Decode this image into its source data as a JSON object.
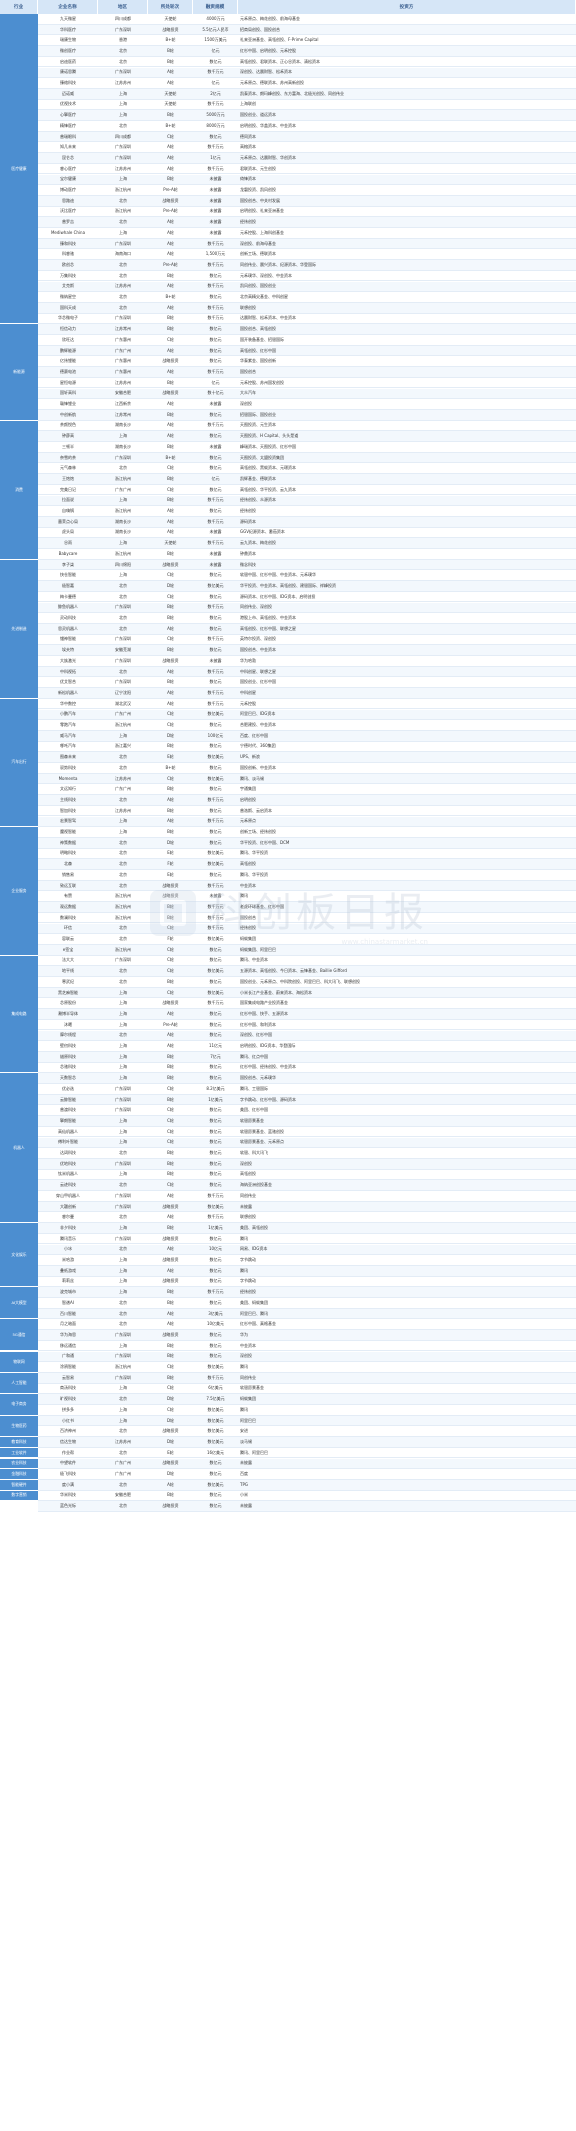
{
  "header": [
    "行业",
    "企业名称",
    "地区",
    "所处轮次",
    "融资规模",
    "投资方"
  ],
  "categories": [
    {
      "name": "医疗健康",
      "rows": 29
    },
    {
      "name": "新能源",
      "rows": 9
    },
    {
      "name": "消费",
      "rows": 13
    },
    {
      "name": "先进制造",
      "rows": 13
    },
    {
      "name": "汽车出行",
      "rows": 12
    },
    {
      "name": "企业服务",
      "rows": 12
    },
    {
      "name": "集成电路",
      "rows": 11
    },
    {
      "name": "机器人",
      "rows": 14
    },
    {
      "name": "文化娱乐",
      "rows": 6
    },
    {
      "name": "AI大模型",
      "rows": 3
    },
    {
      "name": "5G通信",
      "rows": 3
    },
    {
      "name": "物联网",
      "rows": 2
    },
    {
      "name": "人工智能",
      "rows": 2
    },
    {
      "name": "电子商务",
      "rows": 2
    },
    {
      "name": "生物医药",
      "rows": 2
    },
    {
      "name": "教育科技",
      "rows": 1
    },
    {
      "name": "工业软件",
      "rows": 1
    },
    {
      "name": "农业科技",
      "rows": 1
    },
    {
      "name": "金融科技",
      "rows": 1
    },
    {
      "name": "智能硬件",
      "rows": 1
    },
    {
      "name": "数字营销",
      "rows": 1
    }
  ],
  "rows": [
    [
      "九天微星",
      "四川成都",
      "天使轮",
      "4000万元",
      "元禾原点、梅花创投、前海母基金"
    ],
    [
      "华科医疗",
      "广东深圳",
      "战略投资",
      "5.5亿元人民币",
      "招商局创投、国投创合"
    ],
    [
      "瑞康生物",
      "香港",
      "B+轮",
      "1500万美元",
      "礼来亚洲基金、高瓴创投、F-Prime Capital"
    ],
    [
      "微创医疗",
      "北京",
      "B轮",
      "亿元",
      "红杉中国、启明创投、元禾控股"
    ],
    [
      "启迪医药",
      "北京",
      "B轮",
      "数亿元",
      "高瓴创投、君联资本、正心谷资本、清松资本"
    ],
    [
      "康诺思腾",
      "广东深圳",
      "A轮",
      "数千万元",
      "深创投、达晨财智、松禾资本"
    ],
    [
      "臻络科技",
      "江苏苏州",
      "A轮",
      "亿元",
      "元禾原点、德联资本、苏州高新创投"
    ],
    [
      "迈诺威",
      "上海",
      "天使轮",
      "2亿元",
      "凯泰资本、朗玛峰创投、东方富海、北极光创投、同创伟业"
    ],
    [
      "优视技术",
      "上海",
      "天使轮",
      "数千万元",
      "上海联创"
    ],
    [
      "心擎医疗",
      "上海",
      "B轮",
      "5000万元",
      "国投创业、道远资本"
    ],
    [
      "精锋医疗",
      "北京",
      "B+轮",
      "8000万元",
      "启明创投、华盖资本、中金资本"
    ],
    [
      "普瑞眼科",
      "四川成都",
      "C轮",
      "数亿元",
      "德同资本"
    ],
    [
      "知几未来",
      "广东深圳",
      "A轮",
      "数千万元",
      "高榕资本"
    ],
    [
      "昆仑芯",
      "广东深圳",
      "A轮",
      "1亿元",
      "元禾原点、达晨财智、华创资本"
    ],
    [
      "睿心医疗",
      "江苏苏州",
      "A轮",
      "数千万元",
      "君联资本、元生创投"
    ],
    [
      "宝尔健康",
      "上海",
      "B轮",
      "未披露",
      "倚锋资本"
    ],
    [
      "博动医疗",
      "浙江杭州",
      "Pre-A轮",
      "未披露",
      "龙磐投资、凯风创投"
    ],
    [
      "思路迪",
      "北京",
      "战略投资",
      "未披露",
      "国投创合、中关村发展"
    ],
    [
      "沃比医疗",
      "浙江杭州",
      "Pre-A轮",
      "未披露",
      "启明创投、礼来亚洲基金"
    ],
    [
      "普罗吉",
      "北京",
      "A轮",
      "未披露",
      "经纬创投"
    ],
    [
      "Mediwhale China",
      "上海",
      "A轮",
      "未披露",
      "元禾控股、上海科创基金"
    ],
    [
      "臻和科技",
      "广东深圳",
      "A轮",
      "数千万元",
      "深创投、前海母基金"
    ],
    [
      "科睿驰",
      "海南海口",
      "A轮",
      "1,500万元",
      "创新工场、德联资本"
    ],
    [
      "欧创芯",
      "北京",
      "Pre-A轮",
      "数千万元",
      "同创伟业、晨兴资本、纪源资本、华登国际"
    ],
    [
      "万集科技",
      "北京",
      "B轮",
      "数亿元",
      "元禾璞华、深创投、中金资本"
    ],
    [
      "艾克斯",
      "江苏苏州",
      "A轮",
      "数千万元",
      "凯风创投、国投创业"
    ],
    [
      "微纳星空",
      "北京",
      "B+轮",
      "数亿元",
      "北京高精尖基金、中科创星"
    ],
    [
      "国科天成",
      "北京",
      "A轮",
      "数千万元",
      "联想创投"
    ],
    [
      "华芯微电子",
      "广东深圳",
      "B轮",
      "数千万元",
      "达晨财智、松禾资本、中金资本"
    ],
    [
      "恒信动力",
      "江苏常州",
      "B轮",
      "数亿元",
      "国投创合、高瓴创投"
    ],
    [
      "欣旺达",
      "广东惠州",
      "C轮",
      "数亿元",
      "国开装备基金、招银国际"
    ],
    [
      "鹏辉能源",
      "广东广州",
      "A轮",
      "数亿元",
      "高瓴创投、红杉中国"
    ],
    [
      "亿纬锂能",
      "广东惠州",
      "战略投资",
      "数亿元",
      "华泰紫金、国投创新"
    ],
    [
      "德赛电池",
      "广东惠州",
      "A轮",
      "数千万元",
      "国投创合"
    ],
    [
      "星恒电源",
      "江苏苏州",
      "B轮",
      "亿元",
      "元禾控股、苏州国发创投"
    ],
    [
      "国轩高科",
      "安徽合肥",
      "战略投资",
      "数十亿元",
      "大众汽车"
    ],
    [
      "赣锋锂业",
      "江西新余",
      "A轮",
      "未披露",
      "深创投"
    ],
    [
      "中创新航",
      "江苏常州",
      "B轮",
      "数亿元",
      "招银国际、国投创业"
    ],
    [
      "茶颜悦色",
      "湖南长沙",
      "A轮",
      "数千万元",
      "天图投资、元生资本"
    ],
    [
      "钟薛高",
      "上海",
      "A轮",
      "数亿元",
      "天图投资、H Capital、头头是道"
    ],
    [
      "三顿半",
      "湖南长沙",
      "B轮",
      "未披露",
      "峰瑞资本、天图投资、红杉中国"
    ],
    [
      "奈雪的茶",
      "广东深圳",
      "B+轮",
      "数亿元",
      "天图投资、太盟投资集团"
    ],
    [
      "元气森林",
      "北京",
      "C轮",
      "数亿元",
      "高瓴创投、黑蚁资本、元璟资本"
    ],
    [
      "王饱饱",
      "浙江杭州",
      "B轮",
      "亿元",
      "凯辉基金、德联资本"
    ],
    [
      "完美日记",
      "广东广州",
      "C轮",
      "数亿元",
      "高瓴创投、华平投资、云九资本"
    ],
    [
      "拉面说",
      "上海",
      "B轮",
      "数千万元",
      "经纬创投、众源资本"
    ],
    [
      "自嗨锅",
      "浙江杭州",
      "A轮",
      "数亿元",
      "经纬创投"
    ],
    [
      "墨茉点心局",
      "湖南长沙",
      "A轮",
      "数千万元",
      "源码资本"
    ],
    [
      "虎头局",
      "湖南长沙",
      "A轮",
      "未披露",
      "GGV纪源资本、番茄资本"
    ],
    [
      "谷雨",
      "上海",
      "天使轮",
      "数千万元",
      "云九资本、梅花创投"
    ],
    [
      "Babycare",
      "浙江杭州",
      "B轮",
      "未披露",
      "钟鼎资本"
    ],
    [
      "李子柒",
      "四川绵阳",
      "战略投资",
      "未披露",
      "微念科技"
    ],
    [
      "快仓智能",
      "上海",
      "C轮",
      "数亿元",
      "软银中国、红杉中国、中金资本、元禾璞华"
    ],
    [
      "极智嘉",
      "北京",
      "D轮",
      "数亿美元",
      "华平投资、中金资本、高瓴创投、建银国际、祥峰投资"
    ],
    [
      "梅卡曼德",
      "北京",
      "C轮",
      "数亿元",
      "源码资本、红杉中国、IDG资本、启明创投"
    ],
    [
      "鲸鱼机器人",
      "广东深圳",
      "B轮",
      "数千万元",
      "同创伟业、深创投"
    ],
    [
      "灵动科技",
      "北京",
      "B轮",
      "数亿元",
      "港股上市、高瓴创投、中金资本"
    ],
    [
      "思灵机器人",
      "北京",
      "A轮",
      "数亿元",
      "高瓴创投、红杉中国、联想之星"
    ],
    [
      "镭神智能",
      "广东深圳",
      "C轮",
      "数千万元",
      "英特尔投资、深创投"
    ],
    [
      "埃夫特",
      "安徽芜湖",
      "B轮",
      "数亿元",
      "国投创合、中金资本"
    ],
    [
      "大族激光",
      "广东深圳",
      "战略投资",
      "未披露",
      "华为哈勃"
    ],
    [
      "中科视拓",
      "北京",
      "A轮",
      "数千万元",
      "中科创星、联想之星"
    ],
    [
      "优艾智合",
      "广东深圳",
      "B轮",
      "数亿元",
      "国投创业、红杉中国"
    ],
    [
      "新松机器人",
      "辽宁沈阳",
      "A轮",
      "数千万元",
      "中科创星"
    ],
    [
      "华中数控",
      "湖北武汉",
      "A轮",
      "数千万元",
      "元禾控股"
    ],
    [
      "小鹏汽车",
      "广东广州",
      "C轮",
      "数亿美元",
      "阿里巴巴、IDG资本"
    ],
    [
      "零跑汽车",
      "浙江杭州",
      "C轮",
      "数亿元",
      "合肥建投、中金资本"
    ],
    [
      "威马汽车",
      "上海",
      "D轮",
      "100亿元",
      "百度、红杉中国"
    ],
    [
      "哪吒汽车",
      "浙江嘉兴",
      "B轮",
      "数亿元",
      "宁德时代、360集团"
    ],
    [
      "图森未来",
      "北京",
      "E轮",
      "数亿美元",
      "UPS、新浪"
    ],
    [
      "驭势科技",
      "北京",
      "B+轮",
      "数亿元",
      "国投创新、中金资本"
    ],
    [
      "Momenta",
      "江苏苏州",
      "C轮",
      "数亿美元",
      "腾讯、淡马锡"
    ],
    [
      "文远知行",
      "广东广州",
      "B轮",
      "数亿元",
      "宇通集团"
    ],
    [
      "主线科技",
      "北京",
      "A轮",
      "数千万元",
      "启明创投"
    ],
    [
      "智加科技",
      "江苏苏州",
      "B轮",
      "数亿元",
      "普洛斯、云启资本"
    ],
    [
      "宏景智驾",
      "上海",
      "A轮",
      "数千万元",
      "元禾原点"
    ],
    [
      "魔视智能",
      "上海",
      "B轮",
      "数亿元",
      "创新工场、经纬创投"
    ],
    [
      "神策数据",
      "北京",
      "D轮",
      "数亿元",
      "华平投资、红杉中国、DCM"
    ],
    [
      "明略科技",
      "北京",
      "E轮",
      "数亿美元",
      "腾讯、华平投资"
    ],
    [
      "北森",
      "北京",
      "F轮",
      "数亿美元",
      "高瓴创投"
    ],
    [
      "销售易",
      "北京",
      "E轮",
      "数亿元",
      "腾讯、华平投资"
    ],
    [
      "致远互联",
      "北京",
      "战略投资",
      "数千万元",
      "中金资本"
    ],
    [
      "有赞",
      "浙江杭州",
      "战略投资",
      "未披露",
      "腾讯"
    ],
    [
      "观远数据",
      "浙江杭州",
      "B轮",
      "数千万元",
      "老虎环球基金、红杉中国"
    ],
    [
      "数澜科技",
      "浙江杭州",
      "B轮",
      "数千万元",
      "国投创合"
    ],
    [
      "环信",
      "北京",
      "C轮",
      "数千万元",
      "经纬创投"
    ],
    [
      "容联云",
      "北京",
      "F轮",
      "数亿美元",
      "蚂蚁集团"
    ],
    [
      "e签宝",
      "浙江杭州",
      "C轮",
      "数亿元",
      "蚂蚁集团、阿里巴巴"
    ],
    [
      "法大大",
      "广东深圳",
      "C轮",
      "数亿元",
      "腾讯、中金资本"
    ],
    [
      "地平线",
      "北京",
      "C轮",
      "数亿美元",
      "五源资本、高瓴创投、今日资本、云锋基金、Baillie Gifford"
    ],
    [
      "寒武纪",
      "北京",
      "B轮",
      "数亿元",
      "国投创业、元禾原点、中科院创投、阿里巴巴、科大讯飞、联想创投"
    ],
    [
      "黑芝麻智能",
      "上海",
      "C轮",
      "数亿美元",
      "小米长江产业基金、蔚来资本、海松资本"
    ],
    [
      "芯原股份",
      "上海",
      "战略投资",
      "数千万元",
      "国家集成电路产业投资基金"
    ],
    [
      "瀚博半导体",
      "上海",
      "A轮",
      "数亿元",
      "红杉中国、快手、五源资本"
    ],
    [
      "沐曦",
      "上海",
      "Pre-A轮",
      "数亿元",
      "红杉中国、和利资本"
    ],
    [
      "摩尔线程",
      "北京",
      "A轮",
      "数亿元",
      "深创投、红杉中国"
    ],
    [
      "壁仞科技",
      "上海",
      "A轮",
      "11亿元",
      "启明创投、IDG资本、华登国际"
    ],
    [
      "燧原科技",
      "上海",
      "B轮",
      "7亿元",
      "腾讯、红点中国"
    ],
    [
      "芯驰科技",
      "上海",
      "B轮",
      "数亿元",
      "红杉中国、经纬创投、中金资本"
    ],
    [
      "天数智芯",
      "上海",
      "B轮",
      "数亿元",
      "国投创合、元禾璞华"
    ],
    [
      "优必选",
      "广东深圳",
      "C轮",
      "8.2亿美元",
      "腾讯、工银国际"
    ],
    [
      "云鲸智能",
      "广东深圳",
      "B轮",
      "1亿美元",
      "字节跳动、红杉中国、源码资本"
    ],
    [
      "普渡科技",
      "广东深圳",
      "C轮",
      "数亿元",
      "美团、红杉中国"
    ],
    [
      "擎朗智能",
      "上海",
      "C轮",
      "数亿元",
      "软银愿景基金"
    ],
    [
      "高仙机器人",
      "上海",
      "C轮",
      "数亿元",
      "软银愿景基金、蓝驰创投"
    ],
    [
      "傅利叶智能",
      "上海",
      "C轮",
      "数亿元",
      "软银愿景基金、元禾原点"
    ],
    [
      "达闼科技",
      "北京",
      "B轮",
      "数亿元",
      "软银、科大讯飞"
    ],
    [
      "优地科技",
      "广东深圳",
      "B轮",
      "数亿元",
      "深创投"
    ],
    [
      "钛米机器人",
      "上海",
      "B轮",
      "数亿元",
      "高瓴创投"
    ],
    [
      "云迹科技",
      "北京",
      "C轮",
      "数亿元",
      "海纳亚洲创投基金"
    ],
    [
      "穿山甲机器人",
      "广东深圳",
      "A轮",
      "数千万元",
      "同创伟业"
    ],
    [
      "大疆创新",
      "广东深圳",
      "战略投资",
      "数亿美元",
      "未披露"
    ],
    [
      "睿尔曼",
      "北京",
      "A轮",
      "数千万元",
      "联想创投"
    ],
    [
      "非夕科技",
      "上海",
      "B轮",
      "1亿美元",
      "美团、高瓴创投"
    ],
    [
      "腾讯音乐",
      "广东深圳",
      "战略投资",
      "数亿元",
      "腾讯"
    ],
    [
      "小冰",
      "北京",
      "A轮",
      "10亿元",
      "网易、IDG资本"
    ],
    [
      "米哈游",
      "上海",
      "战略投资",
      "数亿元",
      "字节跳动"
    ],
    [
      "叠纸游戏",
      "上海",
      "A轮",
      "数亿元",
      "腾讯"
    ],
    [
      "莉莉丝",
      "上海",
      "战略投资",
      "数亿元",
      "字节跳动"
    ],
    [
      "波克城市",
      "上海",
      "B轮",
      "数千万元",
      "经纬创投"
    ],
    [
      "智谱AI",
      "北京",
      "B轮",
      "数亿元",
      "美团、蚂蚁集团"
    ],
    [
      "百川智能",
      "北京",
      "A轮",
      "3亿美元",
      "阿里巴巴、腾讯"
    ],
    [
      "月之暗面",
      "北京",
      "A轮",
      "10亿美元",
      "红杉中国、真格基金"
    ],
    [
      "华为海思",
      "广东深圳",
      "战略投资",
      "数亿元",
      "华为"
    ],
    [
      "移远通信",
      "上海",
      "B轮",
      "数亿元",
      "中金资本"
    ],
    [
      "广和通",
      "广东深圳",
      "B轮",
      "数亿元",
      "深创投"
    ],
    [
      "涂鸦智能",
      "浙江杭州",
      "C轮",
      "数亿美元",
      "腾讯"
    ],
    [
      "云智易",
      "广东深圳",
      "B轮",
      "数千万元",
      "同创伟业"
    ],
    [
      "商汤科技",
      "上海",
      "C轮",
      "6亿美元",
      "软银愿景基金"
    ],
    [
      "旷视科技",
      "北京",
      "D轮",
      "7.5亿美元",
      "蚂蚁集团"
    ],
    [
      "拼多多",
      "上海",
      "C轮",
      "数亿美元",
      "腾讯"
    ],
    [
      "小红书",
      "上海",
      "D轮",
      "数亿美元",
      "阿里巴巴"
    ],
    [
      "百济神州",
      "北京",
      "战略投资",
      "数亿美元",
      "安进"
    ],
    [
      "信达生物",
      "江苏苏州",
      "D轮",
      "数亿美元",
      "淡马锡"
    ],
    [
      "作业帮",
      "北京",
      "E轮",
      "16亿美元",
      "腾讯、阿里巴巴"
    ],
    [
      "中望软件",
      "广东广州",
      "战略投资",
      "数亿元",
      "未披露"
    ],
    [
      "极飞科技",
      "广东广州",
      "D轮",
      "数亿元",
      "百度"
    ],
    [
      "度小满",
      "北京",
      "A轮",
      "数亿美元",
      "TPG"
    ],
    [
      "华米科技",
      "安徽合肥",
      "B轮",
      "数亿元",
      "小米"
    ],
    [
      "蓝色光标",
      "北京",
      "战略投资",
      "数亿元",
      "未披露"
    ]
  ]
}
